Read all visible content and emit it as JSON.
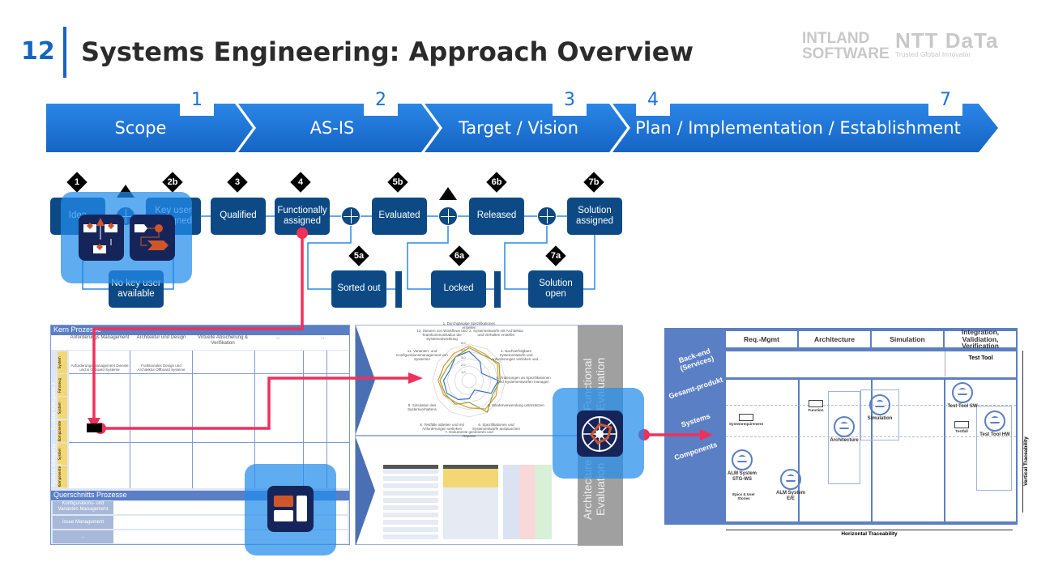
{
  "header": {
    "slide_number": "12",
    "title": "Systems Engineering: Approach Overview"
  },
  "logos": {
    "intland_line1": "INTLAND",
    "intland_line2": "SOFTWARE",
    "ntt": "NTT DaTa",
    "ntt_tagline": "Trusted Global Innovator"
  },
  "phases": [
    {
      "label": "Scope",
      "number": "1"
    },
    {
      "label": "AS-IS",
      "number": "2"
    },
    {
      "label": "Target / Vision",
      "number": "3"
    },
    {
      "label": "Plan / Implementation / Establishment",
      "number": "4",
      "number_end": "7"
    }
  ],
  "workflow": {
    "states": {
      "idea": "Idea",
      "key_user_assigned": "Key user assigned",
      "qualified": "Qualified",
      "functionally_assigned": "Functionally assigned",
      "evaluated": "Evaluated",
      "released": "Released",
      "solution_assigned": "Solution assigned",
      "no_key_user": "No key user available",
      "sorted_out": "Sorted out",
      "locked": "Locked",
      "solution_open": "Solution open"
    },
    "markers": {
      "m1": "1",
      "m2b": "2b",
      "m3": "3",
      "m4": "4",
      "m5b": "5b",
      "m6b": "6b",
      "m7b": "7b",
      "m5a": "5a",
      "m6a": "6a",
      "m7a": "7a"
    }
  },
  "process_map": {
    "kern_title": "Kern Prozesse",
    "columns": [
      "Anforderungs Management",
      "Architektur und Design",
      "Virtuelle Absicherung & Verifikation",
      "...",
      "..."
    ],
    "row_labels": [
      "System",
      "Fahrzeug",
      "System",
      "Komponente",
      "System",
      "Komponente"
    ],
    "group_labels": [
      "System Kategorie 2",
      "System Kategorie 1"
    ],
    "cells": [
      "Anforderungs Management Dienste und & Offboard Systeme",
      "Funktionales Design und Architektur Offboard Systeme"
    ],
    "quer_title": "Querschnitts Prozesse",
    "quer_rows": [
      "Konfigurations- und Varianten Management",
      "Issue Management",
      "..."
    ]
  },
  "evaluation": {
    "functional_label": "Functional Evaluation",
    "architecture_label": "Architecture Evaluation",
    "radar_labels": [
      "1. Durchgängige Spezifikationen erstellen",
      "2. Systementwürfe mit Architektur und Verhalten erstellen",
      "3. Nachverfolgbare Systementwürfe und Anforderungen verlinken und...",
      "4. Änderungen an Spezifikationen und Systementwürfen managen",
      "5. Wiederverwendung unterstützen",
      "6. Spezifikationen und Systementwürfe austauschen",
      "7. Dokumente generieren und Reports",
      "8. Testfälle ableiten und mit Anforderungen verlinken",
      "9. Simulation des Systemverhaltens",
      "11. Varianten- und Konfigurationsmanagement von Systemen",
      "12. Steuern von Workflows und Teamkommunikation der Systementwicklung"
    ],
    "radar_ticks": [
      "5,0",
      "4,0",
      "3,0",
      "2,0",
      "1,0"
    ],
    "series_colors": [
      "#e8953a",
      "#3a6fc4",
      "#8aa83a"
    ]
  },
  "traceability": {
    "columns": [
      "Req.-Mgmt",
      "Architecture",
      "Simulation",
      "Integration, Validiation, Verification"
    ],
    "rows": [
      "Back-end (Services)",
      "Gesamt-produkt",
      "Systems",
      "Components"
    ],
    "test_tool": "Test Tool",
    "nodes": {
      "alm_stg": "ALM System STG-WS",
      "alm_ee": "ALM System E/E",
      "architecture": "Architecture",
      "simulation": "Simulation",
      "test_sw": "Test Tool SW",
      "test_hw": "Test Tool HW"
    },
    "artifacts": {
      "sysreq": "Systemrequirement",
      "function": "Function",
      "testfall": "Testfall",
      "epics": "Epics & User Stories"
    },
    "horizontal": "Horizontal Traceability",
    "vertical": "Vertical Traceability"
  },
  "colors": {
    "brand_blue": "#1565c0",
    "chevron": "#1a73d9",
    "state": "#0d4a85",
    "highlight": "#f0305a",
    "overlay": "#218ceb"
  }
}
